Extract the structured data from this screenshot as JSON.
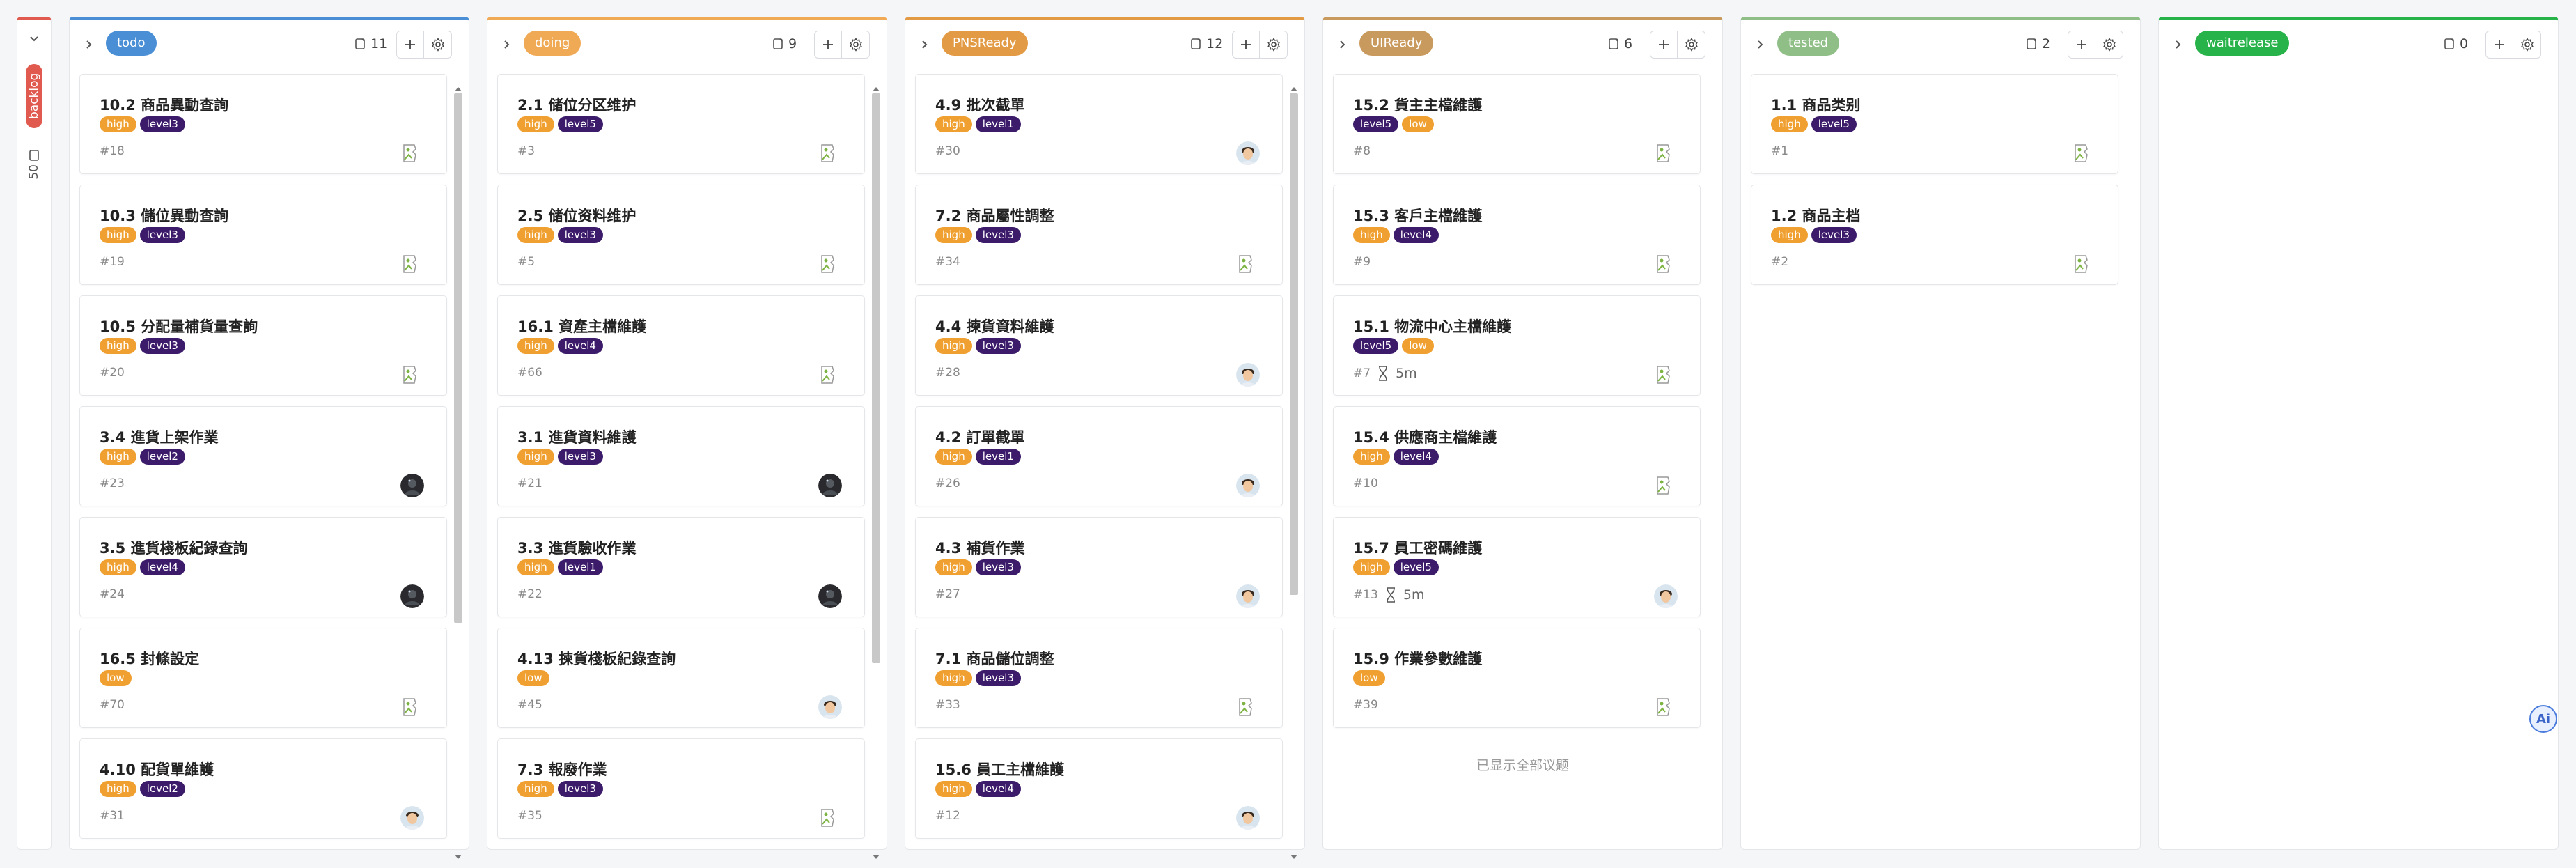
{
  "colors": {
    "backlog": "#e05a4f",
    "todo": "#4a8fd6",
    "doing": "#f0a955",
    "pnsready": "#e39a44",
    "uiready": "#c99a5e",
    "tested": "#8fbf87",
    "waitrelease": "#28b34a",
    "tag_high": "#f0a030",
    "tag_level": "#3d1b6b"
  },
  "backlog": {
    "label": "backlog",
    "count": "50"
  },
  "columns": [
    {
      "key": "todo",
      "label": "todo",
      "count": "11",
      "cards": [
        {
          "title": "10.2 商品異動查詢",
          "tags": [
            "high",
            "level3"
          ],
          "num": "#18",
          "avatar": "broken"
        },
        {
          "title": "10.3 儲位異動查詢",
          "tags": [
            "high",
            "level3"
          ],
          "num": "#19",
          "avatar": "broken"
        },
        {
          "title": "10.5 分配量補貨量查詢",
          "tags": [
            "high",
            "level3"
          ],
          "num": "#20",
          "avatar": "broken"
        },
        {
          "title": "3.4 進貨上架作業",
          "tags": [
            "high",
            "level2"
          ],
          "num": "#23",
          "avatar": "dark"
        },
        {
          "title": "3.5 進貨棧板紀錄查詢",
          "tags": [
            "high",
            "level4"
          ],
          "num": "#24",
          "avatar": "dark"
        },
        {
          "title": "16.5 封條設定",
          "tags": [
            "low"
          ],
          "num": "#70",
          "avatar": "broken"
        },
        {
          "title": "4.10 配貨單維護",
          "tags": [
            "high",
            "level2"
          ],
          "num": "#31",
          "avatar": "photo"
        }
      ]
    },
    {
      "key": "doing",
      "label": "doing",
      "count": "9",
      "cards": [
        {
          "title": "2.1 储位分区维护",
          "tags": [
            "high",
            "level5"
          ],
          "num": "#3",
          "avatar": "broken"
        },
        {
          "title": "2.5 储位资料维护",
          "tags": [
            "high",
            "level3"
          ],
          "num": "#5",
          "avatar": "broken"
        },
        {
          "title": "16.1 資產主檔維護",
          "tags": [
            "high",
            "level4"
          ],
          "num": "#66",
          "avatar": "broken"
        },
        {
          "title": "3.1 進貨資料維護",
          "tags": [
            "high",
            "level3"
          ],
          "num": "#21",
          "avatar": "dark"
        },
        {
          "title": "3.3 進貨驗收作業",
          "tags": [
            "high",
            "level1"
          ],
          "num": "#22",
          "avatar": "dark"
        },
        {
          "title": "4.13 揀貨棧板紀錄查詢",
          "tags": [
            "low"
          ],
          "num": "#45",
          "avatar": "photo"
        },
        {
          "title": "7.3 報廢作業",
          "tags": [
            "high",
            "level3"
          ],
          "num": "#35",
          "avatar": "broken"
        }
      ]
    },
    {
      "key": "pnsready",
      "label": "PNSReady",
      "count": "12",
      "cards": [
        {
          "title": "4.9 批次截單",
          "tags": [
            "high",
            "level1"
          ],
          "num": "#30",
          "avatar": "photo"
        },
        {
          "title": "7.2 商品屬性調整",
          "tags": [
            "high",
            "level3"
          ],
          "num": "#34",
          "avatar": "broken"
        },
        {
          "title": "4.4 揀貨資料維護",
          "tags": [
            "high",
            "level3"
          ],
          "num": "#28",
          "avatar": "photo"
        },
        {
          "title": "4.2 訂單截單",
          "tags": [
            "high",
            "level1"
          ],
          "num": "#26",
          "avatar": "photo"
        },
        {
          "title": "4.3 補貨作業",
          "tags": [
            "high",
            "level3"
          ],
          "num": "#27",
          "avatar": "photo"
        },
        {
          "title": "7.1 商品儲位調整",
          "tags": [
            "high",
            "level3"
          ],
          "num": "#33",
          "avatar": "broken"
        },
        {
          "title": "15.6 員工主檔維護",
          "tags": [
            "high",
            "level4"
          ],
          "num": "#12",
          "avatar": "photo"
        }
      ]
    },
    {
      "key": "uiready",
      "label": "UIReady",
      "count": "6",
      "all_shown": "已显示全部议题",
      "cards": [
        {
          "title": "15.2 貨主主檔維護",
          "tags": [
            "level5",
            "low"
          ],
          "num": "#8",
          "avatar": "broken"
        },
        {
          "title": "15.3 客戶主檔維護",
          "tags": [
            "high",
            "level4"
          ],
          "num": "#9",
          "avatar": "broken"
        },
        {
          "title": "15.1 物流中心主檔維護",
          "tags": [
            "level5",
            "low"
          ],
          "num": "#7",
          "hours": "5m",
          "avatar": "broken"
        },
        {
          "title": "15.4 供應商主檔維護",
          "tags": [
            "high",
            "level4"
          ],
          "num": "#10",
          "avatar": "broken"
        },
        {
          "title": "15.7 員工密碼維護",
          "tags": [
            "high",
            "level5"
          ],
          "num": "#13",
          "hours": "5m",
          "avatar": "photo"
        },
        {
          "title": "15.9 作業參數維護",
          "tags": [
            "low"
          ],
          "num": "#39",
          "avatar": "broken"
        }
      ]
    },
    {
      "key": "tested",
      "label": "tested",
      "count": "2",
      "cards": [
        {
          "title": "1.1 商品类别",
          "tags": [
            "high",
            "level5"
          ],
          "num": "#1",
          "avatar": "broken"
        },
        {
          "title": "1.2 商品主档",
          "tags": [
            "high",
            "level3"
          ],
          "num": "#2",
          "avatar": "broken"
        }
      ]
    },
    {
      "key": "waitrelease",
      "label": "waitrelease",
      "count": "0",
      "cards": []
    }
  ],
  "ai_button": {
    "label": "Ai",
    "icon": "ai-assistant-icon"
  }
}
